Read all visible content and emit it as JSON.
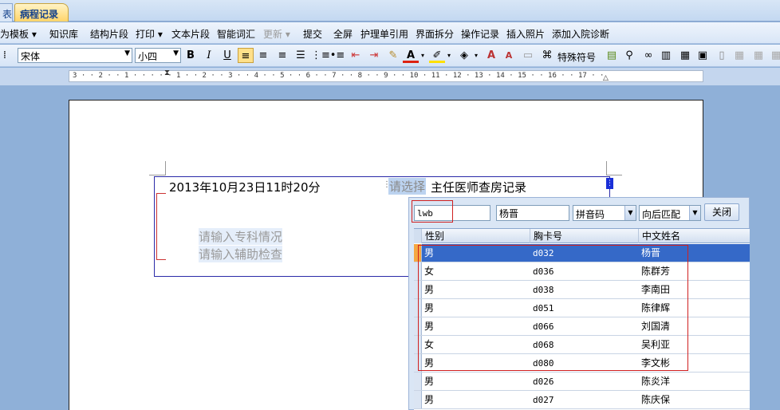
{
  "tabs": [
    {
      "label": "表",
      "active": false
    },
    {
      "label": "病程记录",
      "active": true
    }
  ],
  "menu": {
    "items": [
      {
        "label": "为模板",
        "dropdown": true,
        "enabled": true
      },
      {
        "label": "知识库",
        "dropdown": false,
        "enabled": true
      },
      {
        "label": "结构片段",
        "dropdown": false,
        "enabled": true
      },
      {
        "label": "打印",
        "dropdown": true,
        "enabled": true
      },
      {
        "label": "文本片段",
        "dropdown": false,
        "enabled": true
      },
      {
        "label": "智能词汇",
        "dropdown": false,
        "enabled": true
      },
      {
        "label": "更新",
        "dropdown": true,
        "enabled": false
      },
      {
        "label": "提交",
        "dropdown": false,
        "enabled": true
      },
      {
        "label": "全屏",
        "dropdown": false,
        "enabled": true
      },
      {
        "label": "护理单引用",
        "dropdown": false,
        "enabled": true
      },
      {
        "label": "界面拆分",
        "dropdown": false,
        "enabled": true
      },
      {
        "label": "操作记录",
        "dropdown": false,
        "enabled": true
      },
      {
        "label": "插入照片",
        "dropdown": false,
        "enabled": true
      },
      {
        "label": "添加入院诊断",
        "dropdown": false,
        "enabled": true
      }
    ]
  },
  "format": {
    "font_name": "宋体",
    "font_size": "小四",
    "bold": "B",
    "italic": "I",
    "underline": "U",
    "special_symbol": "特殊符号"
  },
  "ruler": {
    "text": "3 · · 2 · · 1 · · ·   · · 1 · · 2 · · 3 · · 4 · · 5 · · 6 · · 7 · · 8 · · 9 · · 10 · 11 · 12 · 13 · 14 ·   15 · · 16 · · 17 · ·"
  },
  "document": {
    "datetime": "2013年10月23日11时20分",
    "select_placeholder": "请选择",
    "title_suffix": "主任医师查房记录",
    "placeholder_1": "请输入专科情况",
    "placeholder_2": "请输入辅助检查"
  },
  "search_popup": {
    "query": "lwb",
    "selected_name": "杨晋",
    "mode": "拼音码",
    "match": "向后匹配",
    "close_label": "关闭",
    "columns": [
      "性别",
      "胸卡号",
      "中文姓名"
    ],
    "rows": [
      {
        "gender": "男",
        "card": "d032",
        "name": "杨晋",
        "selected": true
      },
      {
        "gender": "女",
        "card": "d036",
        "name": "陈群芳",
        "selected": false
      },
      {
        "gender": "男",
        "card": "d038",
        "name": "李南田",
        "selected": false
      },
      {
        "gender": "男",
        "card": "d051",
        "name": "陈律辉",
        "selected": false
      },
      {
        "gender": "男",
        "card": "d066",
        "name": "刘国清",
        "selected": false
      },
      {
        "gender": "女",
        "card": "d068",
        "name": "吴利亚",
        "selected": false
      },
      {
        "gender": "男",
        "card": "d080",
        "name": "李文彬",
        "selected": false
      },
      {
        "gender": "男",
        "card": "d026",
        "name": "陈炎洋",
        "selected": false
      },
      {
        "gender": "男",
        "card": "d027",
        "name": "陈庆保",
        "selected": false
      }
    ]
  },
  "colors": {
    "selection": "#3569c8",
    "annotation_red": "#d02020",
    "textbox_border": "#2a2aa8"
  }
}
